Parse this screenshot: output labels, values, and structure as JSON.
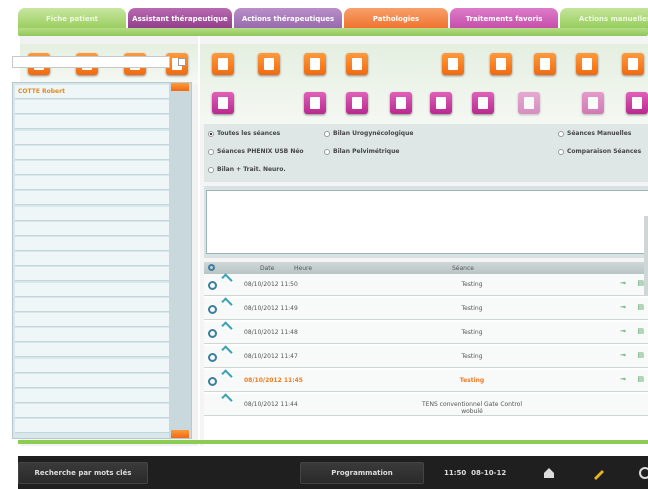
{
  "tabs": [
    {
      "label": "Fiche patient"
    },
    {
      "label": "Assistant thérapeutique"
    },
    {
      "label": "Actions thérapeutiques"
    },
    {
      "label": "Pathologies"
    },
    {
      "label": "Traitements favoris"
    },
    {
      "label": "Actions manuelles"
    }
  ],
  "left": {
    "search_value": "",
    "patients": [
      "COTTE Robert",
      "",
      "",
      "",
      "",
      "",
      "",
      "",
      "",
      "",
      "",
      "",
      "",
      "",
      "",
      "",
      "",
      "",
      "",
      "",
      "",
      "",
      ""
    ]
  },
  "options": {
    "toutes": "Toutes les séances",
    "bilan_uro": "Bilan Urogynécologique",
    "manuelles": "Séances Manuelles",
    "phenix": "Séances PHENIX USB Néo",
    "bilan_pelvi": "Bilan Pelvimétrique",
    "comparaison": "Comparaison Séances",
    "neuro": "Bilan + Trait. Neuro."
  },
  "sessions": {
    "header": {
      "date": "Date",
      "heure": "Heure",
      "seance": "Séance"
    },
    "rows": [
      {
        "date": "08/10/2012",
        "time": "11:50",
        "seance": "Testing",
        "highlight": false
      },
      {
        "date": "08/10/2012",
        "time": "11:49",
        "seance": "Testing",
        "highlight": false
      },
      {
        "date": "08/10/2012",
        "time": "11:48",
        "seance": "Testing",
        "highlight": false
      },
      {
        "date": "08/10/2012",
        "time": "11:47",
        "seance": "Testing",
        "highlight": false
      },
      {
        "date": "08/10/2012",
        "time": "11:45",
        "seance": "Testing",
        "highlight": true
      },
      {
        "date": "08/10/2012",
        "time": "11:44",
        "seance": "TENS conventionnel Gate Control wobulé",
        "highlight": false
      }
    ]
  },
  "footer": {
    "search_label": "Recherche par mots clés",
    "program_label": "Programmation",
    "clock": "11:50",
    "date": "08-10-12"
  },
  "colors": {
    "accent_orange": "#f07a20",
    "accent_green": "#8dcc52",
    "accent_magenta": "#c44aa8"
  }
}
